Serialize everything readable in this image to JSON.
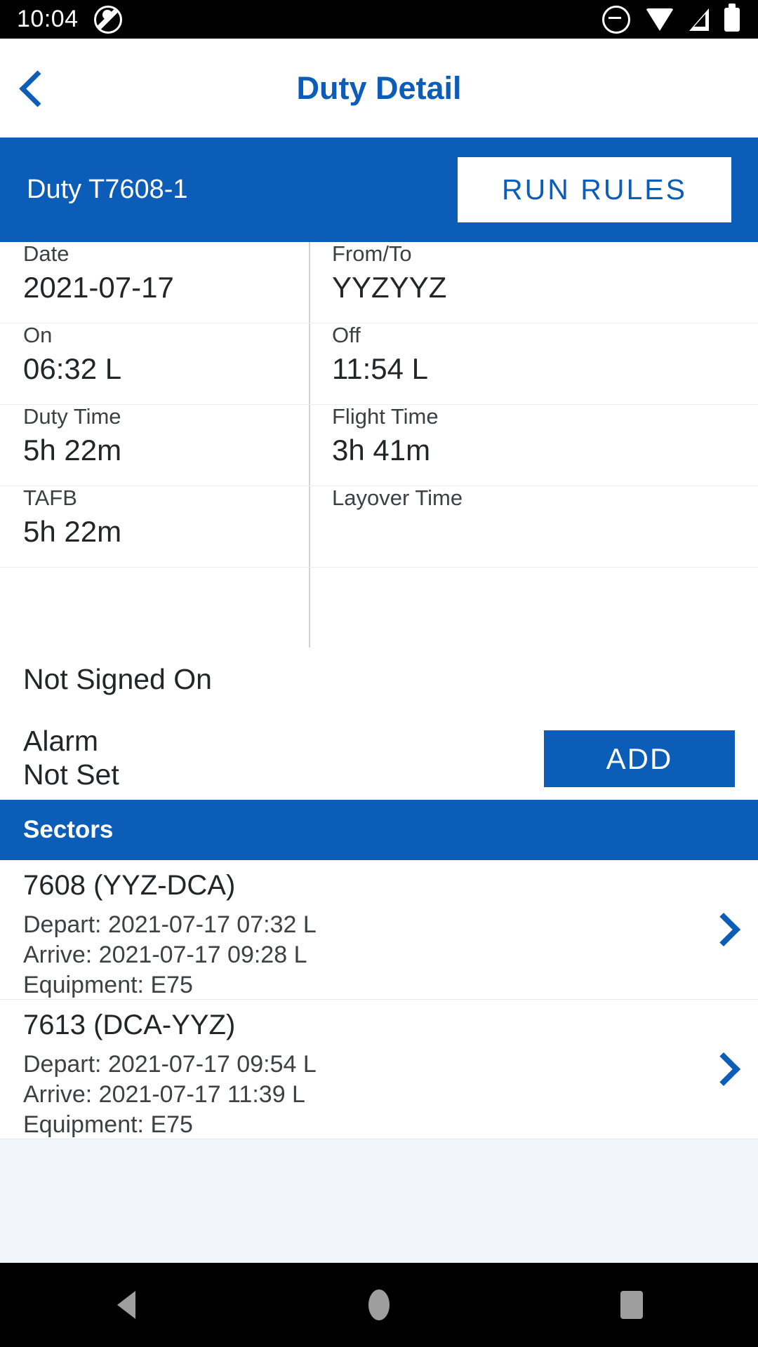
{
  "status_bar": {
    "time": "10:04",
    "left_icons": [
      "notification-slash-icon"
    ],
    "right_icons": [
      "do-not-disturb-icon",
      "wifi-icon",
      "cellular-signal-icon",
      "battery-icon"
    ]
  },
  "app_bar": {
    "back_icon": "chevron-left-icon",
    "title": "Duty Detail"
  },
  "duty_header": {
    "duty_label": "Duty T7608-1",
    "run_rules_label": "RUN RULES"
  },
  "details": {
    "date": {
      "label": "Date",
      "value": "2021-07-17"
    },
    "from_to": {
      "label": "From/To",
      "value": "YYZYYZ"
    },
    "on": {
      "label": "On",
      "value": "06:32 L"
    },
    "off": {
      "label": "Off",
      "value": "11:54 L"
    },
    "duty_time": {
      "label": "Duty Time",
      "value": "5h 22m"
    },
    "flight_time": {
      "label": "Flight Time",
      "value": "3h 41m"
    },
    "tafb": {
      "label": "TAFB",
      "value": "5h 22m"
    },
    "layover_time": {
      "label": "Layover Time",
      "value": ""
    }
  },
  "sign_on": {
    "status": "Not Signed On"
  },
  "alarm": {
    "label": "Alarm",
    "value": "Not Set",
    "add_label": "ADD"
  },
  "sectors": {
    "header": "Sectors",
    "chevron_icon": "chevron-right-icon",
    "items": [
      {
        "flight": "7608 (YYZ-DCA)",
        "depart": "Depart: 2021-07-17 07:32 L",
        "arrive": "Arrive: 2021-07-17 09:28 L",
        "equipment": "Equipment: E75"
      },
      {
        "flight": "7613 (DCA-YYZ)",
        "depart": "Depart: 2021-07-17 09:54 L",
        "arrive": "Arrive: 2021-07-17 11:39 L",
        "equipment": "Equipment: E75"
      }
    ]
  },
  "nav_bar": {
    "back_icon": "triangle-back-icon",
    "home_icon": "circle-home-icon",
    "recents_icon": "square-recents-icon"
  },
  "colors": {
    "brand_blue": "#0B5DB8",
    "status_bar_bg": "#000000",
    "page_bg": "#F2F6FA",
    "text_primary": "#232629",
    "text_secondary": "#3d4144"
  }
}
